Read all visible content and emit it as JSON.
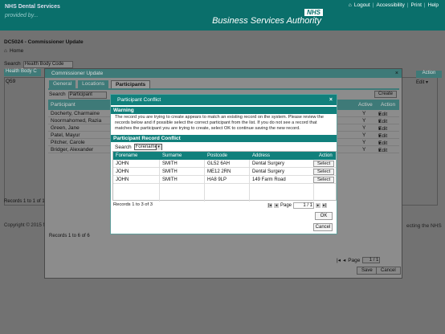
{
  "header": {
    "brand": "NHS Dental Services",
    "tagline": "provided by...",
    "links": [
      "Logout",
      "Accessibility",
      "Print",
      "Help"
    ],
    "nhs_logo": "NHS",
    "org_name": "Business Services Authority"
  },
  "page": {
    "title": "DC5024 - Commissioner Update",
    "home": "Home",
    "search_label": "Search",
    "search_value": "Health Body Code",
    "panel_tab": "Health Body C",
    "code": "Q59",
    "records": "Records 1 to 1 of 1",
    "copyright": "Copyright © 2015 N",
    "protecting": "ecting the NHS",
    "action_col": "Action",
    "edit": "Edit"
  },
  "commissioner_dialog": {
    "title": "Commissioner Update",
    "close": "×",
    "tabs": [
      "General",
      "Locations",
      "Participants"
    ],
    "search_label": "Search",
    "search_value": "Participant",
    "create": "Create",
    "columns": {
      "participant": "Participant",
      "active": "Active",
      "action": "Action"
    },
    "rows": [
      {
        "name": "Docherty, Charmaine",
        "active": "Y",
        "action": "Edit"
      },
      {
        "name": "Noormahomed, Razia",
        "active": "Y",
        "action": "Edit"
      },
      {
        "name": "Green, Jane",
        "active": "Y",
        "action": "Edit"
      },
      {
        "name": "Patel, Mayur",
        "active": "Y",
        "action": "Edit"
      },
      {
        "name": "Pitcher, Carole",
        "active": "Y",
        "action": "Edit"
      },
      {
        "name": "Bridger, Alexander",
        "active": "Y",
        "action": "Edit"
      }
    ],
    "records": "Records 1 to 6 of 6",
    "page_label": "Page",
    "page_value": "1 / 1",
    "save": "Save",
    "cancel": "Cancel"
  },
  "conflict_dialog": {
    "title": "Participant Conflict",
    "close": "×",
    "warning_heading": "Warning",
    "message": "The record you are trying to create appears to match an existing record on the system. Please review the records below and if possible select the correct participant from the list. If you do not see a record that matches the participant you are trying to create, select OK to continue saving the new record.",
    "record_heading": "Participant Record Conflict",
    "search_label": "Search",
    "search_value": "Forename",
    "columns": [
      "Forename",
      "Surname",
      "Postcode",
      "Address",
      "Action"
    ],
    "rows": [
      {
        "forename": "JOHN",
        "surname": "SMITH",
        "postcode": "GL52 6AH",
        "address": "Dental Surgery",
        "action": "Select"
      },
      {
        "forename": "JOHN",
        "surname": "SMITH",
        "postcode": "ME12 2RN",
        "address": "Dental Surgery",
        "action": "Select"
      },
      {
        "forename": "JOHN",
        "surname": "SMITH",
        "postcode": "HA8 9LP",
        "address": "149 Farm Road",
        "action": "Select"
      }
    ],
    "records": "Records 1 to 3 of 3",
    "page_label": "Page",
    "page_value": "1 / 1",
    "ok": "OK",
    "cancel": "Cancel"
  },
  "colors": {
    "teal": "#11807c",
    "overlay_grey": "#727272"
  }
}
